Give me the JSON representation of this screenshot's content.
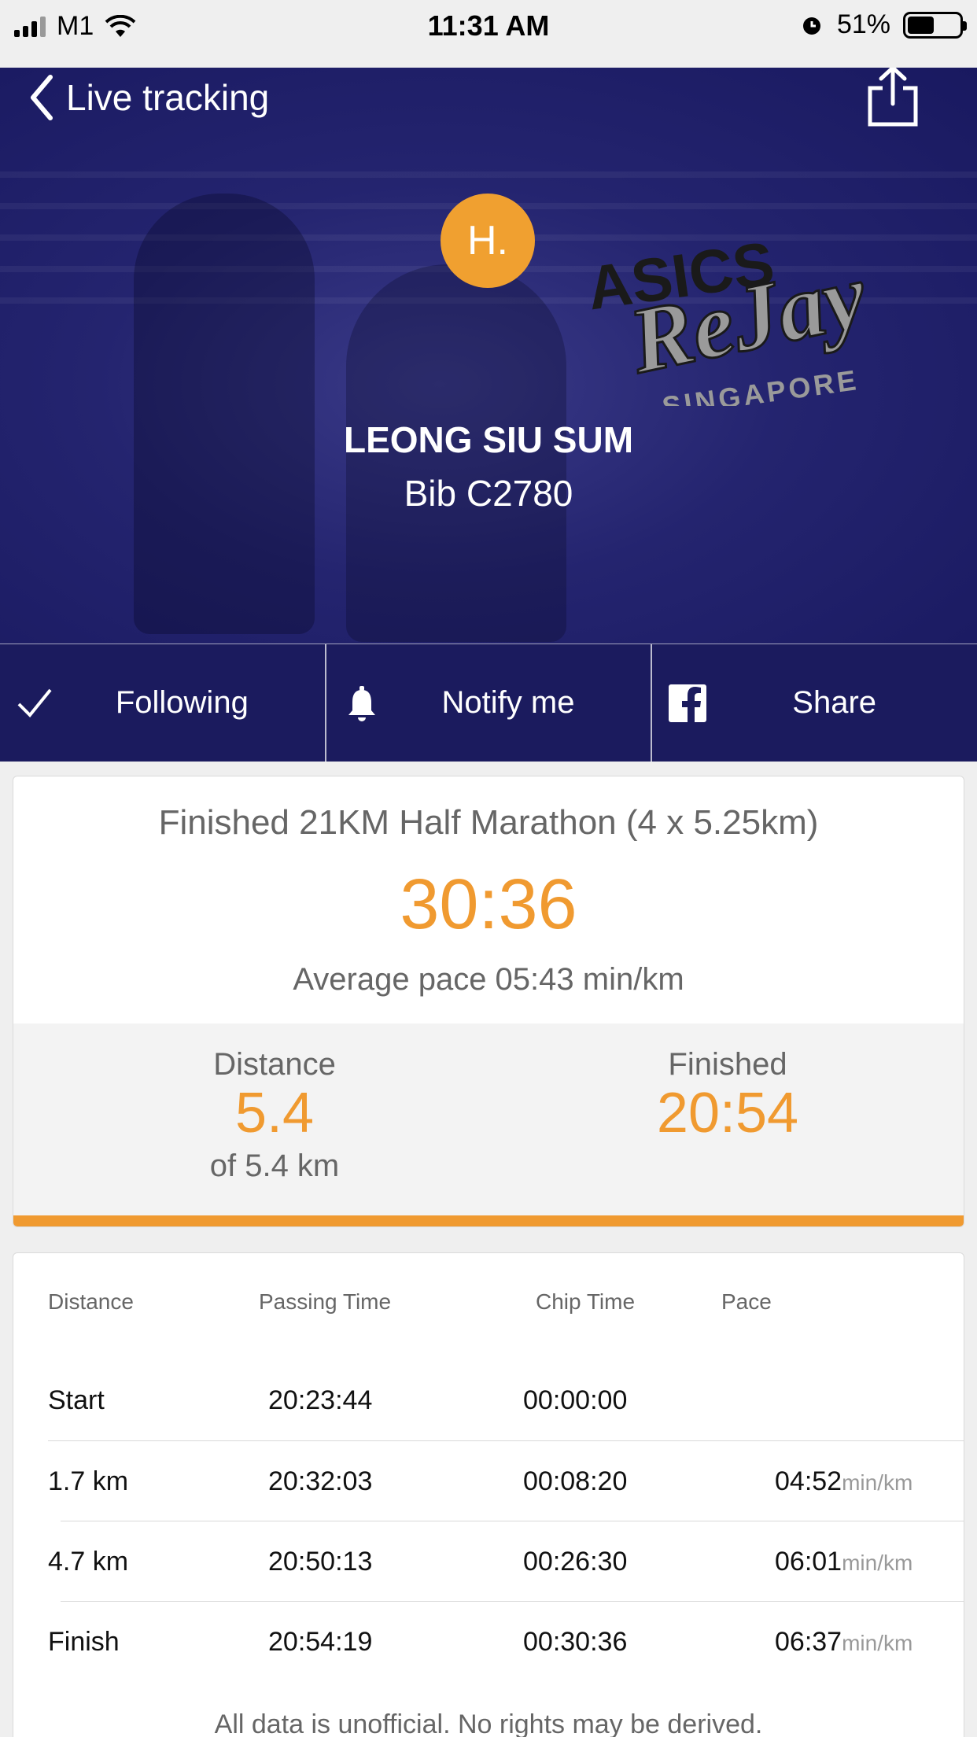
{
  "status_bar": {
    "carrier": "M1",
    "time": "11:31 AM",
    "battery": "51%",
    "battery_level": 0.51
  },
  "nav": {
    "back_label": "Live tracking"
  },
  "runner": {
    "initials": "H.",
    "name": "LEONG SIU SUM",
    "bib": "Bib C2780"
  },
  "logo": {
    "line1": "ASICS",
    "line2": "ReJay",
    "line3": "SINGAPORE"
  },
  "actions": {
    "following": "Following",
    "notify": "Notify me",
    "share": "Share"
  },
  "summary": {
    "title": "Finished 21KM Half Marathon (4 x 5.25km)",
    "total_time": "30:36",
    "avg_pace": "Average pace 05:43 min/km",
    "distance_label": "Distance",
    "distance_value": "5.4",
    "distance_sub": "of 5.4 km",
    "finished_label": "Finished",
    "finished_value": "20:54",
    "progress": 1.0
  },
  "splits": {
    "headers": [
      "Distance",
      "Passing Time",
      "Chip Time",
      "Pace"
    ],
    "rows": [
      {
        "distance": "Start",
        "passing": "20:23:44",
        "chip": "00:00:00",
        "pace": "",
        "unit": ""
      },
      {
        "distance": "1.7 km",
        "passing": "20:32:03",
        "chip": "00:08:20",
        "pace": "04:52",
        "unit": "min/km"
      },
      {
        "distance": "4.7 km",
        "passing": "20:50:13",
        "chip": "00:26:30",
        "pace": "06:01",
        "unit": "min/km"
      },
      {
        "distance": "Finish",
        "passing": "20:54:19",
        "chip": "00:30:36",
        "pace": "06:37",
        "unit": "min/km"
      }
    ],
    "footer": "All data is unofficial. No rights may be derived."
  },
  "colors": {
    "accent": "#f09a30",
    "hero_bg": "#24246f",
    "action_bar": "#1b1b5e"
  }
}
